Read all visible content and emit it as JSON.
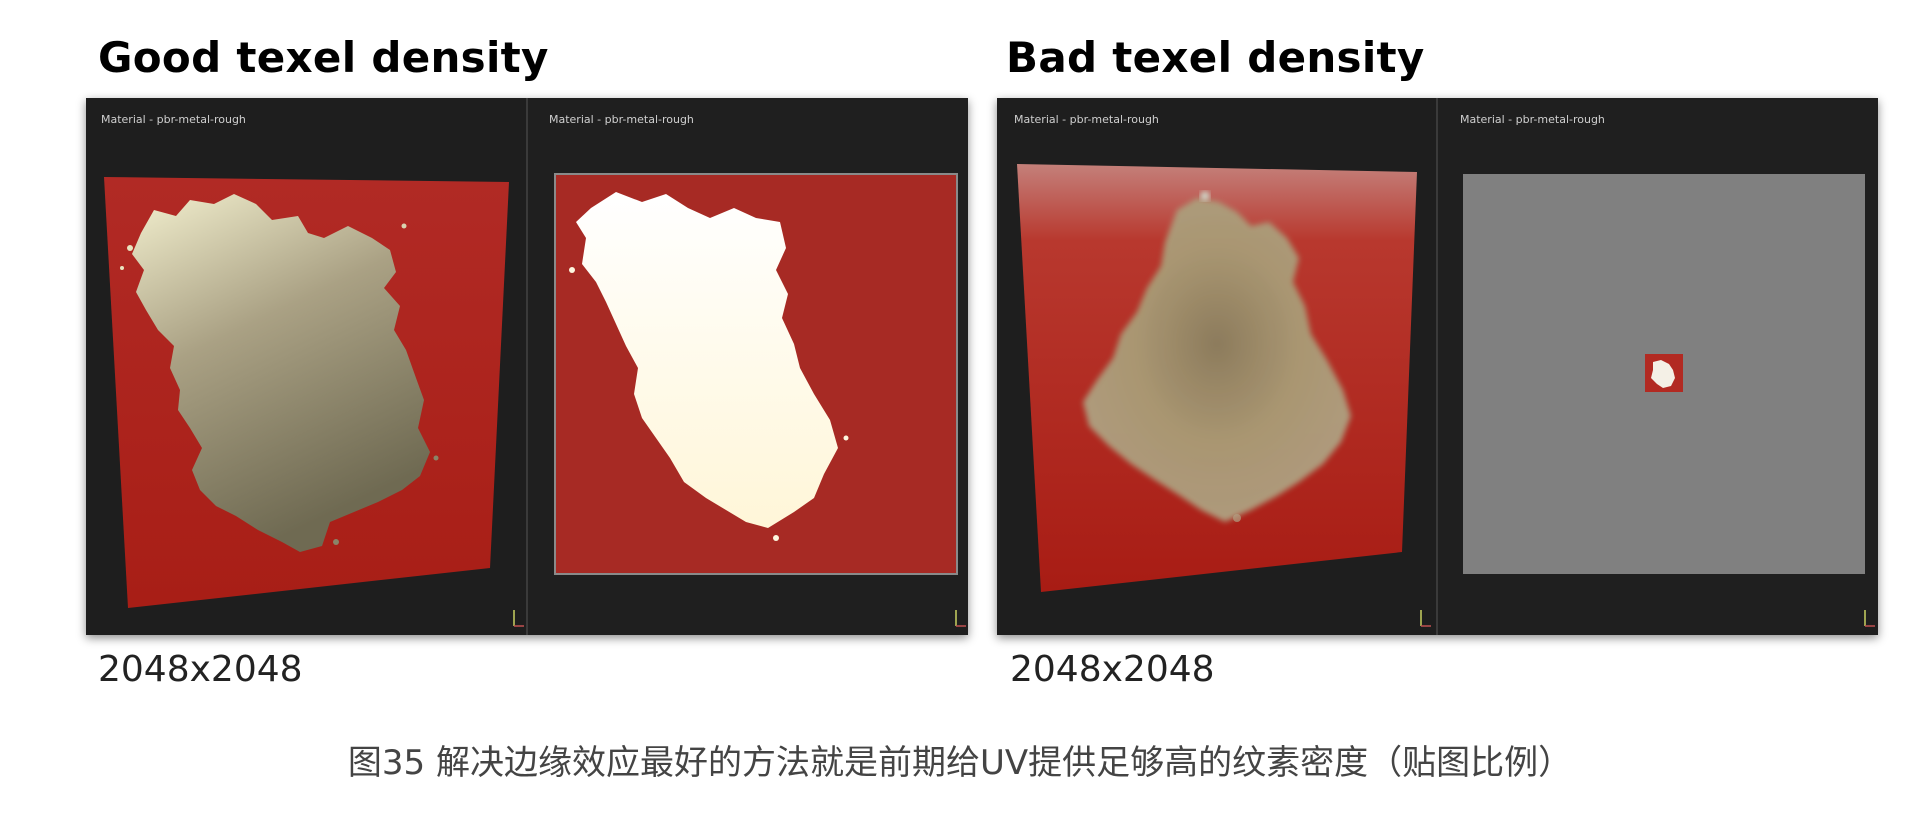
{
  "left_figure": {
    "title": "Good texel density",
    "viewport_left_label": "Material - pbr-metal-rough",
    "viewport_right_label": "Material - pbr-metal-rough",
    "resolution": "2048x2048"
  },
  "right_figure": {
    "title": "Bad texel density",
    "viewport_left_label": "Material - pbr-metal-rough",
    "viewport_right_label": "Material - pbr-metal-rough",
    "resolution": "2048x2048"
  },
  "caption": "图35 解决边缘效应最好的方法就是前期给UV提供足够高的纹素密度（贴图比例）",
  "colors": {
    "viewport_bg": "#1e1e1e",
    "plane_red": "#b3221c",
    "uv_gray": "#808080",
    "metal_gold": "#b0a27a",
    "metal_white": "#fffbe6"
  },
  "icons": {
    "axis_gizmo": "axis-gizmo-icon"
  }
}
